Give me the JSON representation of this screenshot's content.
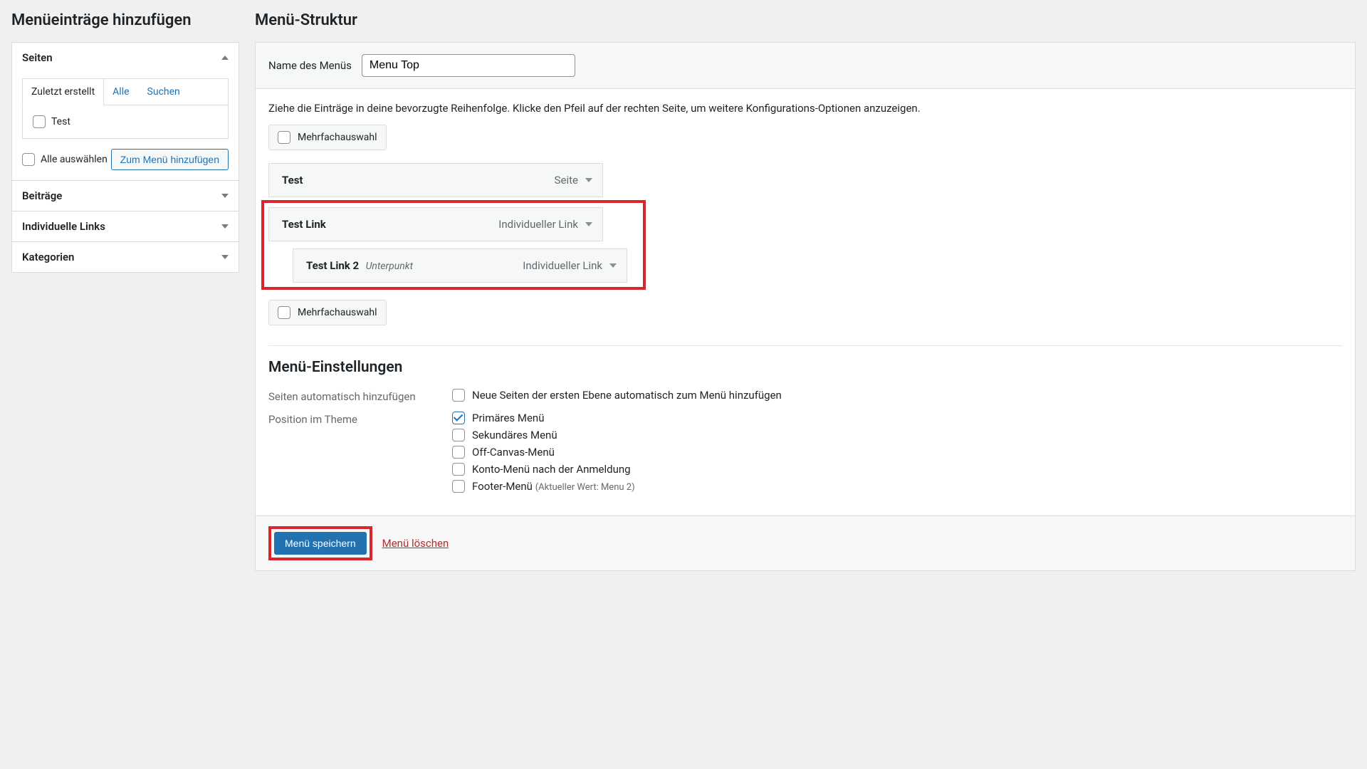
{
  "left": {
    "heading": "Menüeinträge hinzufügen",
    "panels": [
      {
        "title": "Seiten",
        "open": true
      },
      {
        "title": "Beiträge",
        "open": false
      },
      {
        "title": "Individuelle Links",
        "open": false
      },
      {
        "title": "Kategorien",
        "open": false
      }
    ],
    "tabs": {
      "recent": "Zuletzt erstellt",
      "all": "Alle",
      "search": "Suchen"
    },
    "page_item": "Test",
    "select_all": "Alle auswählen",
    "add_to_menu": "Zum Menü hinzufügen"
  },
  "right": {
    "heading": "Menü-Struktur",
    "name_label": "Name des Menüs",
    "name_value": "Menu Top",
    "instructions": "Ziehe die Einträge in deine bevorzugte Reihenfolge. Klicke den Pfeil auf der rechten Seite, um weitere Konfigurations-Optionen anzuzeigen.",
    "bulk_label": "Mehrfachauswahl",
    "items": [
      {
        "name": "Test",
        "type": "Seite",
        "indent": 0,
        "sub": ""
      },
      {
        "name": "Test Link",
        "type": "Individueller Link",
        "indent": 0,
        "sub": ""
      },
      {
        "name": "Test Link 2",
        "type": "Individueller Link",
        "indent": 1,
        "sub": "Unterpunkt"
      }
    ],
    "settings": {
      "heading": "Menü-Einstellungen",
      "auto_add_label": "Seiten automatisch hinzufügen",
      "auto_add_option": "Neue Seiten der ersten Ebene automatisch zum Menü hinzufügen",
      "position_label": "Position im Theme",
      "locations": [
        {
          "label": "Primäres Menü",
          "checked": true,
          "hint": ""
        },
        {
          "label": "Sekundäres Menü",
          "checked": false,
          "hint": ""
        },
        {
          "label": "Off-Canvas-Menü",
          "checked": false,
          "hint": ""
        },
        {
          "label": "Konto-Menü nach der Anmeldung",
          "checked": false,
          "hint": ""
        },
        {
          "label": "Footer-Menü",
          "checked": false,
          "hint": "(Aktueller Wert: Menu 2)"
        }
      ]
    },
    "save": "Menü speichern",
    "delete": "Menü löschen"
  }
}
